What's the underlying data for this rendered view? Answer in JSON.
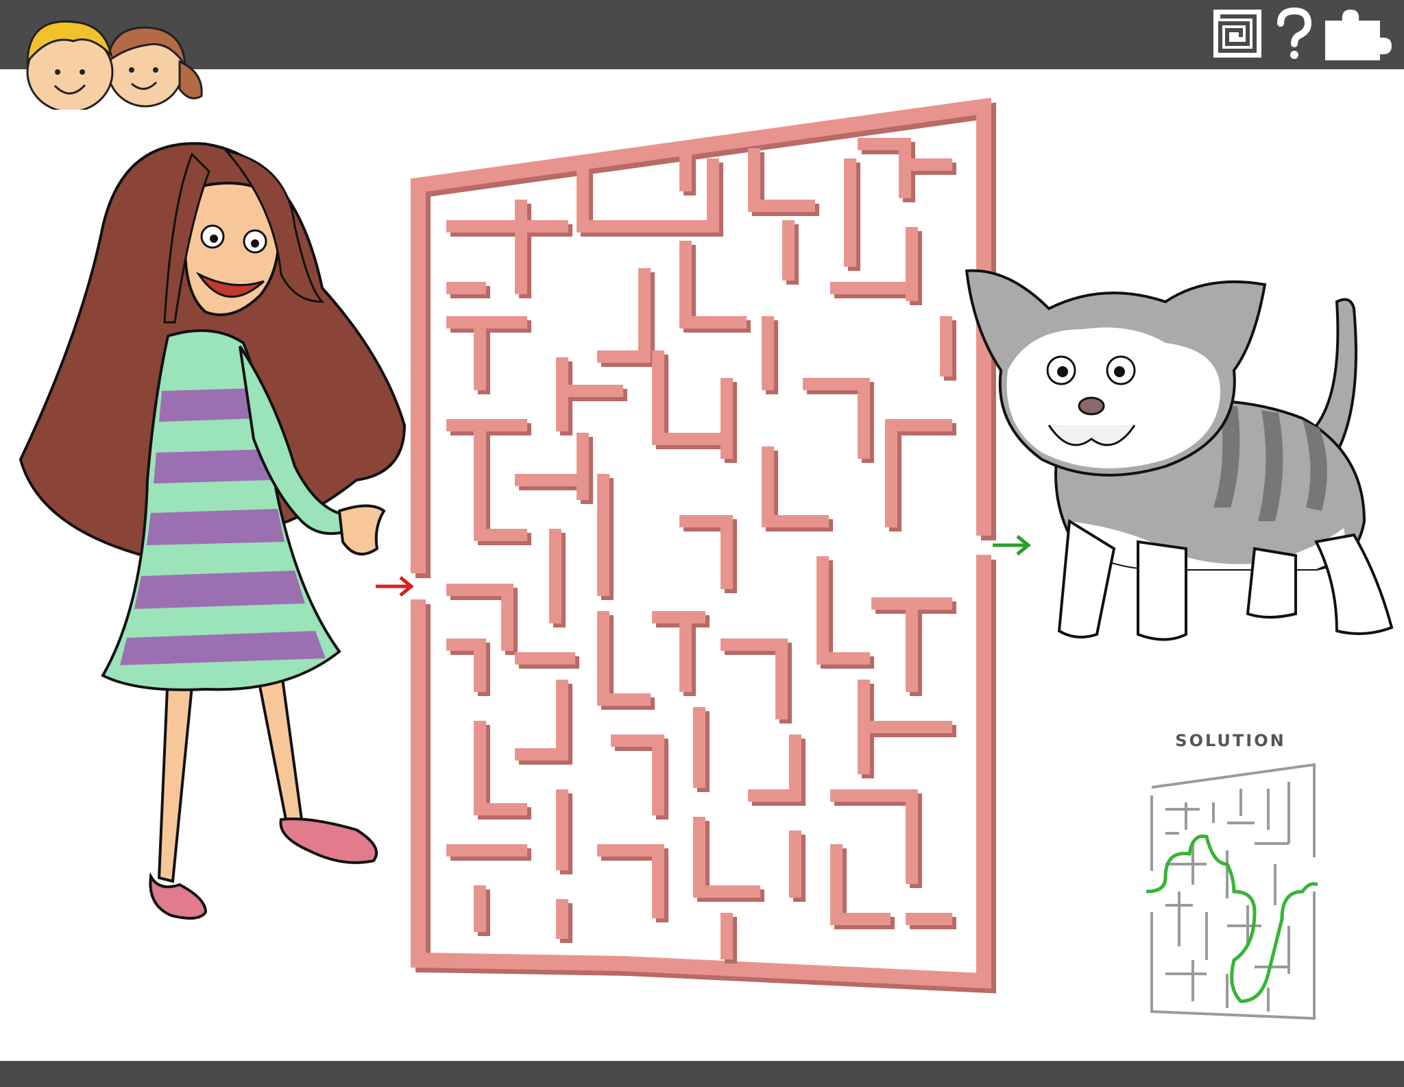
{
  "header": {
    "icons": [
      "kids-faces-logo",
      "maze-icon",
      "question-mark-icon",
      "puzzle-piece-icon"
    ],
    "bar_color": "#4a4a4a"
  },
  "puzzle": {
    "type": "maze",
    "start_arrow_color": "#d91f1f",
    "end_arrow_color": "#2a9d2a",
    "maze_color": "#e8948e",
    "start_character": "girl",
    "end_character": "kitten"
  },
  "solution": {
    "label": "SOLUTION",
    "path_color": "#35b535"
  }
}
